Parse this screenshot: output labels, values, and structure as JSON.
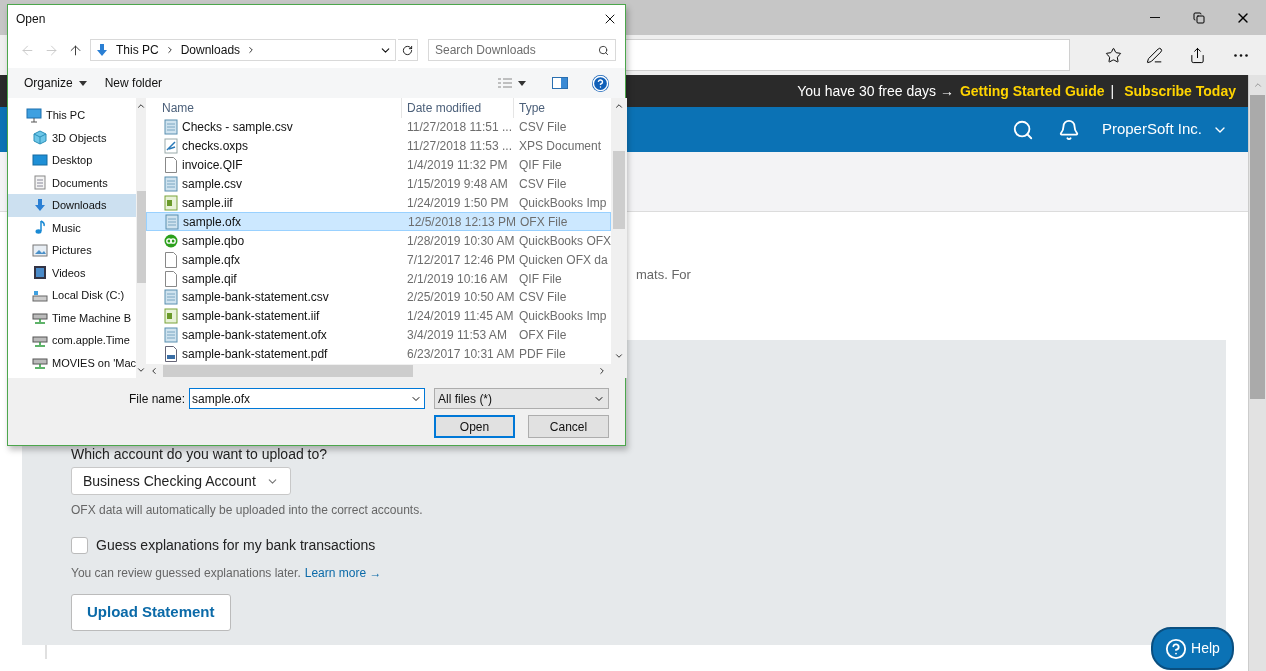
{
  "banner": {
    "message": "You have 30 free days →",
    "links": [
      {
        "label": "Getting Started Guide"
      },
      {
        "label": "Subscribe Today"
      }
    ],
    "separator": "|"
  },
  "header": {
    "account": "ProperSoft Inc."
  },
  "page": {
    "intro_fragment": "mats. For",
    "upload_form": {
      "account_label": "Which account do you want to upload to?",
      "account_select": {
        "value": "Business Checking Account"
      },
      "account_hint": "OFX data will automatically be uploaded into the correct accounts.",
      "guess_checkbox": {
        "label": "Guess explanations for my bank transactions",
        "checked": false
      },
      "review_hint": {
        "text": "You can review guessed explanations later.",
        "link": "Learn more →"
      },
      "upload_button": "Upload Statement"
    }
  },
  "help_button": "Help",
  "dialog": {
    "title": "Open",
    "nav_buttons": [
      {
        "kind": "back",
        "disabled": true
      },
      {
        "kind": "forward",
        "disabled": true
      },
      {
        "kind": "up",
        "disabled": false
      }
    ],
    "breadcrumb": [
      "This PC",
      "Downloads"
    ],
    "search": {
      "placeholder": "Search Downloads"
    },
    "toolbar": {
      "organize": "Organize",
      "new_folder": "New folder"
    },
    "nav": [
      {
        "label": "This PC",
        "kind": "pc",
        "selected": false,
        "children": [
          {
            "label": "3D Objects",
            "kind": "cube",
            "selected": false
          },
          {
            "label": "Desktop",
            "kind": "desktop",
            "selected": false
          },
          {
            "label": "Documents",
            "kind": "documents",
            "selected": false
          },
          {
            "label": "Downloads",
            "kind": "downloads",
            "selected": true
          },
          {
            "label": "Music",
            "kind": "music",
            "selected": false
          },
          {
            "label": "Pictures",
            "kind": "pictures",
            "selected": false
          },
          {
            "label": "Videos",
            "kind": "videos",
            "selected": false
          },
          {
            "label": "Local Disk (C:)",
            "kind": "disk",
            "selected": false
          },
          {
            "label": "Time Machine B",
            "kind": "drive",
            "selected": false
          },
          {
            "label": "com.apple.Time",
            "kind": "drive",
            "selected": false
          },
          {
            "label": "MOVIES on 'Mac",
            "kind": "drive",
            "selected": false
          }
        ]
      }
    ],
    "columns": [
      "Name",
      "Date modified",
      "Type"
    ],
    "files": [
      {
        "name": "Checks - sample.csv",
        "date": "11/27/2018 11:51 ...",
        "type": "CSV File",
        "kind": "notepad",
        "selected": false
      },
      {
        "name": "checks.oxps",
        "date": "11/27/2018 11:53 ...",
        "type": "XPS Document",
        "kind": "xps",
        "selected": false
      },
      {
        "name": "invoice.QIF",
        "date": "1/4/2019 11:32 PM",
        "type": "QIF File",
        "kind": "blank",
        "selected": false
      },
      {
        "name": "sample.csv",
        "date": "1/15/2019 9:48 AM",
        "type": "CSV File",
        "kind": "notepad",
        "selected": false
      },
      {
        "name": "sample.iif",
        "date": "1/24/2019 1:50 PM",
        "type": "QuickBooks Imp",
        "kind": "iif",
        "selected": false
      },
      {
        "name": "sample.ofx",
        "date": "12/5/2018 12:13 PM",
        "type": "OFX File",
        "kind": "notepad",
        "selected": true
      },
      {
        "name": "sample.qbo",
        "date": "1/28/2019 10:30 AM",
        "type": "QuickBooks OFX",
        "kind": "qbo",
        "selected": false
      },
      {
        "name": "sample.qfx",
        "date": "7/12/2017 12:46 PM",
        "type": "Quicken OFX da",
        "kind": "blank",
        "selected": false
      },
      {
        "name": "sample.qif",
        "date": "2/1/2019 10:16 AM",
        "type": "QIF File",
        "kind": "blank",
        "selected": false
      },
      {
        "name": "sample-bank-statement.csv",
        "date": "2/25/2019 10:50 AM",
        "type": "CSV File",
        "kind": "notepad",
        "selected": false
      },
      {
        "name": "sample-bank-statement.iif",
        "date": "1/24/2019 11:45 AM",
        "type": "QuickBooks Imp",
        "kind": "iif",
        "selected": false
      },
      {
        "name": "sample-bank-statement.ofx",
        "date": "3/4/2019 11:53 AM",
        "type": "OFX File",
        "kind": "notepad",
        "selected": false
      },
      {
        "name": "sample-bank-statement.pdf",
        "date": "6/23/2017 10:31 AM",
        "type": "PDF File",
        "kind": "pdf",
        "selected": false
      }
    ],
    "file_name": {
      "label": "File name:",
      "value": "sample.ofx"
    },
    "file_type": {
      "value": "All files (*)"
    },
    "buttons": {
      "open": "Open",
      "cancel": "Cancel"
    }
  }
}
